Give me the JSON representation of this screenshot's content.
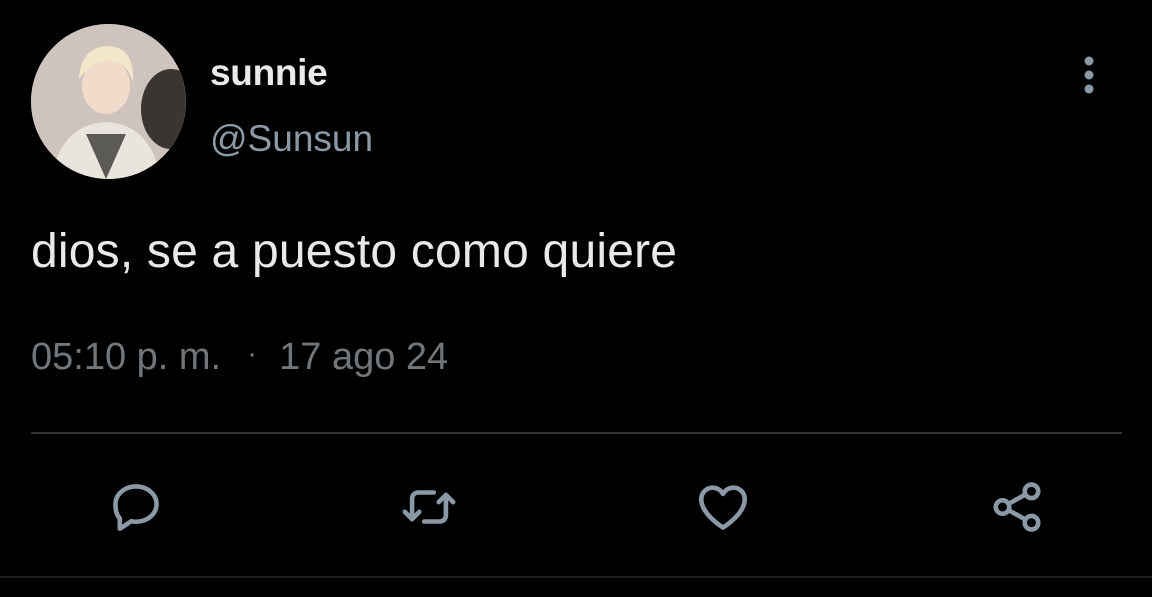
{
  "tweet": {
    "display_name": "sunnie",
    "handle": "@Sunsun",
    "text": "dios, se a puesto como quiere",
    "time": "05:10 p. m.",
    "separator": "·",
    "date": "17 ago 24"
  },
  "actions": {
    "reply_icon": "reply-icon",
    "retweet_icon": "retweet-icon",
    "like_icon": "heart-icon",
    "share_icon": "share-icon"
  },
  "colors": {
    "background": "#000000",
    "primary_text": "#e7e9ea",
    "secondary_text": "#71767b",
    "icon": "#8b98a5",
    "divider": "#2f3336"
  }
}
